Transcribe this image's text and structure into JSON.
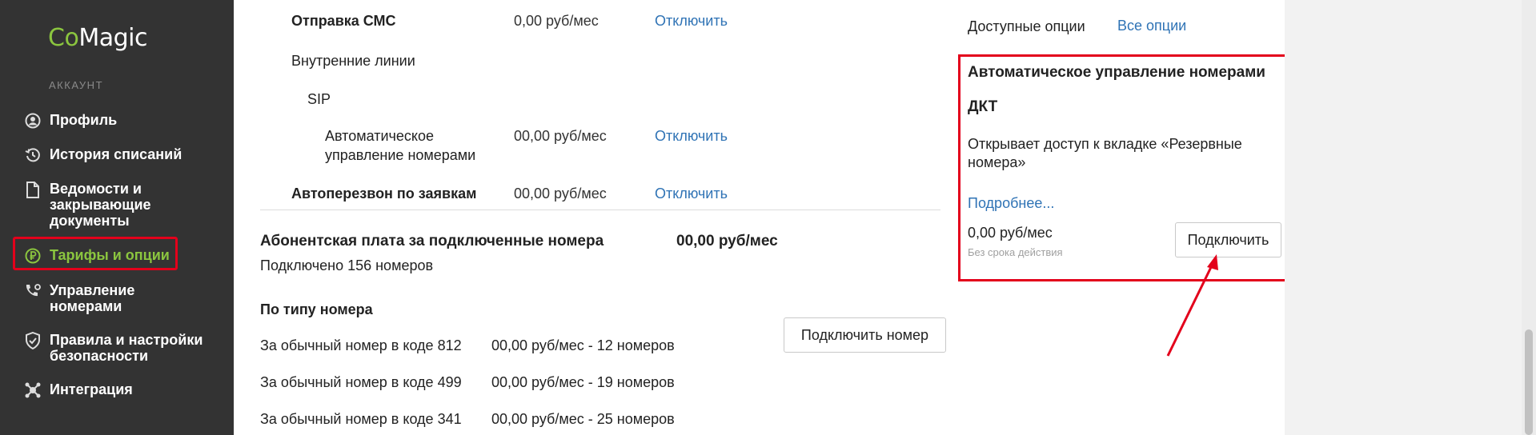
{
  "sidebar": {
    "logo": {
      "co": "Co",
      "magic": "Magic"
    },
    "section_label": "АККАУНТ",
    "items": [
      {
        "label": "Профиль",
        "icon": "user-circle-icon"
      },
      {
        "label": "История списаний",
        "icon": "history-icon"
      },
      {
        "label": "Ведомости и закрывающие документы",
        "icon": "document-icon"
      },
      {
        "label": "Тарифы и опции",
        "icon": "ruble-circle-icon",
        "active": true
      },
      {
        "label": "Управление номерами",
        "icon": "phone-settings-icon"
      },
      {
        "label": "Правила и настройки безопасности",
        "icon": "shield-icon"
      },
      {
        "label": "Интеграция",
        "icon": "integration-icon"
      }
    ],
    "accent_color": "#8bc53f"
  },
  "options": {
    "sms": {
      "name": "Отправка СМС",
      "price": "0,00 руб/мес",
      "action": "Отключить"
    },
    "internal_lines": {
      "name": "Внутренние линии"
    },
    "sip": {
      "name": "SIP"
    },
    "auto_mgmt": {
      "name_line1": "Автоматическое",
      "name_line2": "управление номерами",
      "price": "00,00 руб/мес",
      "action": "Отключить"
    },
    "callback": {
      "name": "Автоперезвон по заявкам",
      "price": "00,00 руб/мес",
      "action": "Отключить"
    }
  },
  "subscription": {
    "title": "Абонентская плата за подключенные номера",
    "price": "00,00 руб/мес",
    "connected": "Подключено 156 номеров",
    "by_type_label": "По типу номера",
    "connect_number_button": "Подключить номер",
    "rows": [
      {
        "label": "За обычный номер в коде 812",
        "value": "00,00 руб/мес - 12 номеров"
      },
      {
        "label": "За обычный номер в коде 499",
        "value": "00,00 руб/мес - 19 номеров"
      },
      {
        "label": "За обычный номер в коде 341",
        "value": "00,00 руб/мес - 25 номеров"
      }
    ]
  },
  "available": {
    "label": "Доступные опции",
    "all_link": "Все опции",
    "card": {
      "title": "Автоматическое управление номерами",
      "subtitle": "ДКТ",
      "description_line1": "Открывает доступ к вкладке «Резервные",
      "description_line2": "номера»",
      "more_link": "Подробнее...",
      "price": "0,00 руб/мес",
      "term": "Без срока действия",
      "connect_button": "Подключить"
    }
  },
  "colors": {
    "sidebar_bg": "#333333",
    "link": "#2f73b5",
    "highlight": "#e3001b"
  }
}
